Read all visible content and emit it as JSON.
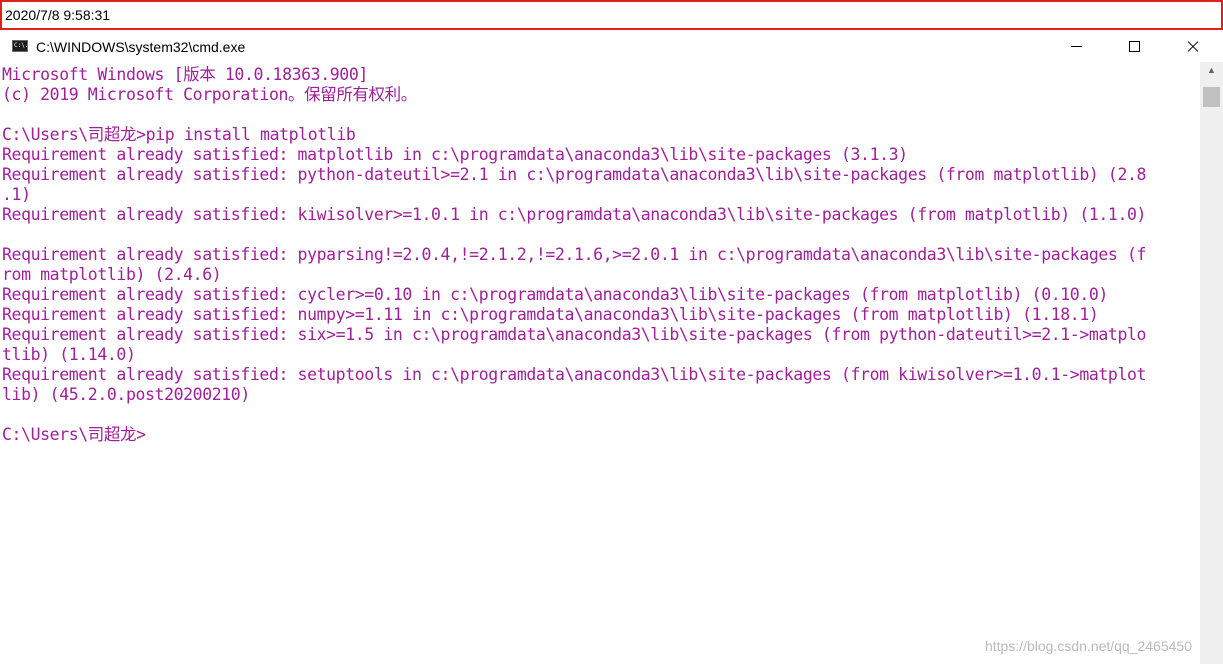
{
  "timestamp": "2020/7/8 9:58:31",
  "window": {
    "title": "C:\\WINDOWS\\system32\\cmd.exe",
    "icon_label": "C:\\."
  },
  "console": {
    "lines": [
      "Microsoft Windows [版本 10.0.18363.900]",
      "(c) 2019 Microsoft Corporation。保留所有权利。",
      "",
      "C:\\Users\\司超龙>pip install matplotlib",
      "Requirement already satisfied: matplotlib in c:\\programdata\\anaconda3\\lib\\site-packages (3.1.3)",
      "Requirement already satisfied: python-dateutil>=2.1 in c:\\programdata\\anaconda3\\lib\\site-packages (from matplotlib) (2.8",
      ".1)",
      "Requirement already satisfied: kiwisolver>=1.0.1 in c:\\programdata\\anaconda3\\lib\\site-packages (from matplotlib) (1.1.0)",
      "",
      "Requirement already satisfied: pyparsing!=2.0.4,!=2.1.2,!=2.1.6,>=2.0.1 in c:\\programdata\\anaconda3\\lib\\site-packages (f",
      "rom matplotlib) (2.4.6)",
      "Requirement already satisfied: cycler>=0.10 in c:\\programdata\\anaconda3\\lib\\site-packages (from matplotlib) (0.10.0)",
      "Requirement already satisfied: numpy>=1.11 in c:\\programdata\\anaconda3\\lib\\site-packages (from matplotlib) (1.18.1)",
      "Requirement already satisfied: six>=1.5 in c:\\programdata\\anaconda3\\lib\\site-packages (from python-dateutil>=2.1->matplo",
      "tlib) (1.14.0)",
      "Requirement already satisfied: setuptools in c:\\programdata\\anaconda3\\lib\\site-packages (from kiwisolver>=1.0.1->matplot",
      "lib) (45.2.0.post20200210)",
      "",
      "C:\\Users\\司超龙>"
    ]
  },
  "watermark": "https://blog.csdn.net/qq_2465450",
  "colors": {
    "console_text": "#a0209a",
    "timestamp_border": "#e0201b",
    "background": "#ffffff"
  },
  "icons": {
    "minimize": "minimize-icon",
    "maximize": "maximize-icon",
    "close": "close-icon",
    "scroll_up": "chevron-up-icon"
  }
}
